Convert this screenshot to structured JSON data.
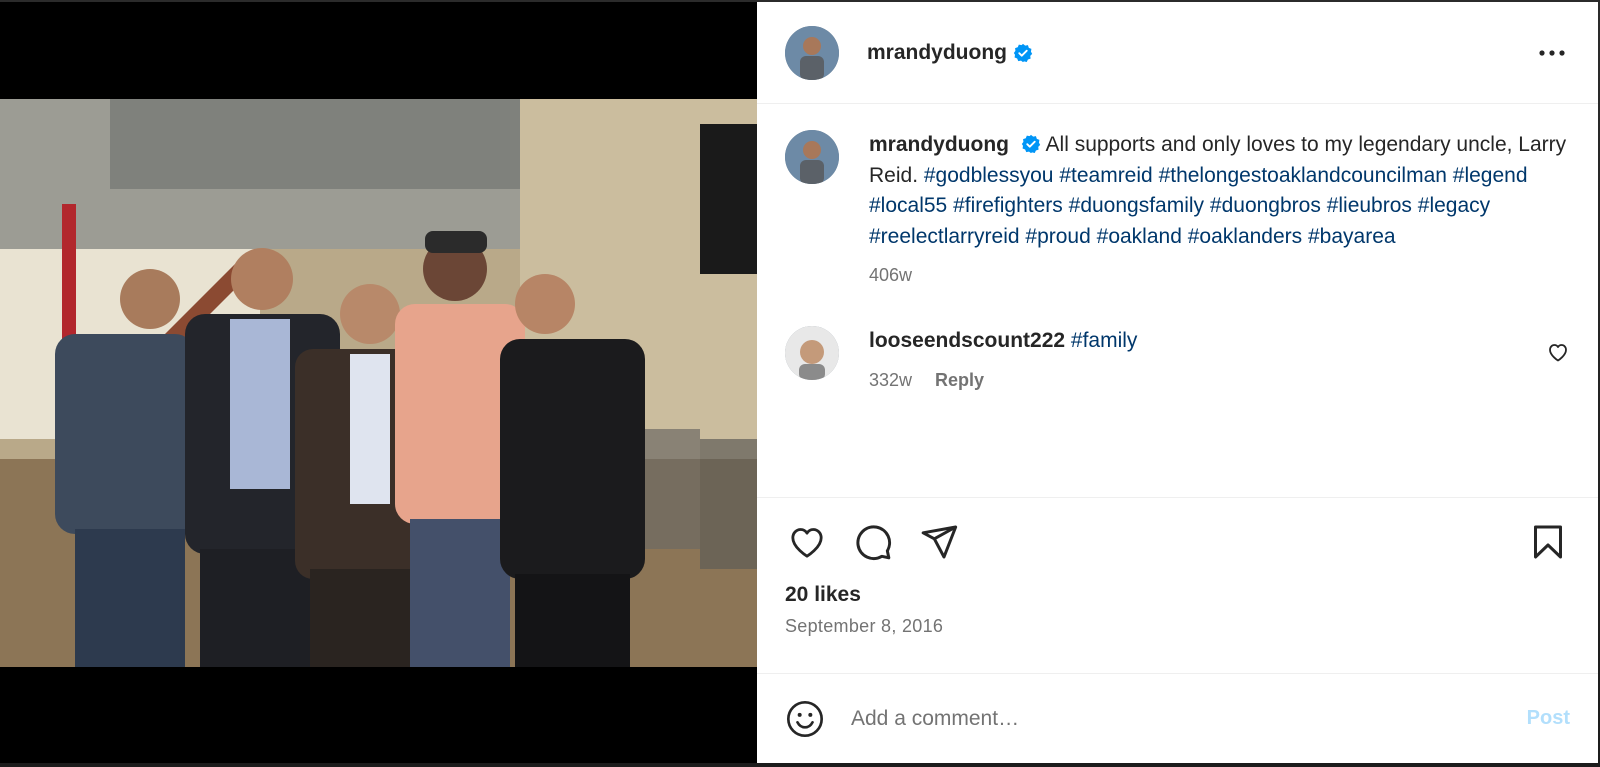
{
  "post": {
    "username": "mrandyduong",
    "verified": true,
    "more_icon": "more-horizontal-icon",
    "photo_description": "Five men posing together in a hall",
    "caption": {
      "username": "mrandyduong",
      "text": "All supports and only loves to my legendary uncle, Larry Reid.",
      "hashtags": [
        "#godblessyou",
        "#teamreid",
        "#thelongestoaklandcouncilman",
        "#legend",
        "#local55",
        "#firefighters",
        "#duongsfamily",
        "#duongbros",
        "#lieubros",
        "#legacy",
        "#reelectlarryreid",
        "#proud",
        "#oakland",
        "#oaklanders",
        "#bayarea"
      ],
      "age": "406w"
    },
    "comments": [
      {
        "username": "looseendscount222",
        "hashtag": "#family",
        "age": "332w",
        "reply_label": "Reply"
      }
    ],
    "likes": "20 likes",
    "date": "September 8, 2016",
    "add_comment_placeholder": "Add a comment…",
    "post_label": "Post",
    "colors": {
      "link": "#00376b",
      "verified": "#0095f6",
      "post_disabled": "#b2dffc"
    }
  }
}
